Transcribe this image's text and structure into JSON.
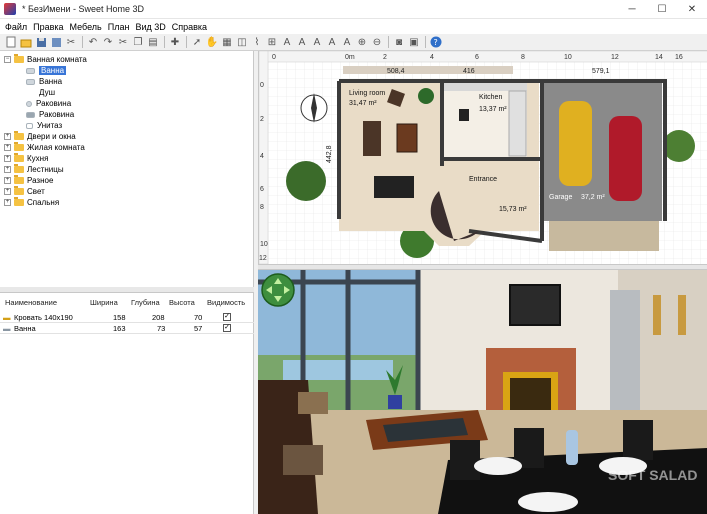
{
  "window": {
    "title": "* БезИмени - Sweet Home 3D"
  },
  "menu": [
    "Файл",
    "Правка",
    "Мебель",
    "План",
    "Вид 3D",
    "Справка"
  ],
  "window_controls": {
    "minimize": "─",
    "maximize": "☐",
    "close": "✕"
  },
  "catalog": {
    "categories": [
      {
        "label": "Ванная комната",
        "expanded": true,
        "items": [
          "Ванна",
          "Ванна",
          "Душ",
          "Раковина",
          "Раковина",
          "Унитаз"
        ],
        "selected_index": 0
      },
      {
        "label": "Двери и окна"
      },
      {
        "label": "Жилая комната"
      },
      {
        "label": "Кухня"
      },
      {
        "label": "Лестницы"
      },
      {
        "label": "Разное"
      },
      {
        "label": "Свет"
      },
      {
        "label": "Спальня"
      }
    ]
  },
  "furniture_table": {
    "headers": [
      "Наименование",
      "Ширина",
      "Глубина",
      "Высота",
      "Видимость"
    ],
    "rows": [
      {
        "name": "Кровать 140x190",
        "width": "158",
        "depth": "208",
        "height": "70",
        "visible": true
      },
      {
        "name": "Ванна",
        "width": "163",
        "depth": "73",
        "height": "57",
        "visible": true
      }
    ]
  },
  "plan": {
    "ruler_x": [
      "0",
      "0m",
      "2",
      "4",
      "6",
      "8",
      "10",
      "12",
      "14",
      "16"
    ],
    "ruler_y": [
      "0",
      "2",
      "4",
      "6",
      "8",
      "10",
      "12"
    ],
    "dimensions": [
      "508,4",
      "416",
      "579,1",
      "442,8"
    ],
    "rooms": [
      {
        "name": "Living room",
        "area": "31,47 m²"
      },
      {
        "name": "Kitchen",
        "area": "13,37 m²"
      },
      {
        "name": "Entrance",
        "area": "15,73 m²"
      },
      {
        "name": "Garage",
        "area": "37,2 m²"
      }
    ]
  },
  "watermark": "SOFT SALAD",
  "colors": {
    "selection": "#3875d7",
    "folder": "#f5c242",
    "plan_floor": "#e9dcc7",
    "wall": "#3a3a3a"
  }
}
